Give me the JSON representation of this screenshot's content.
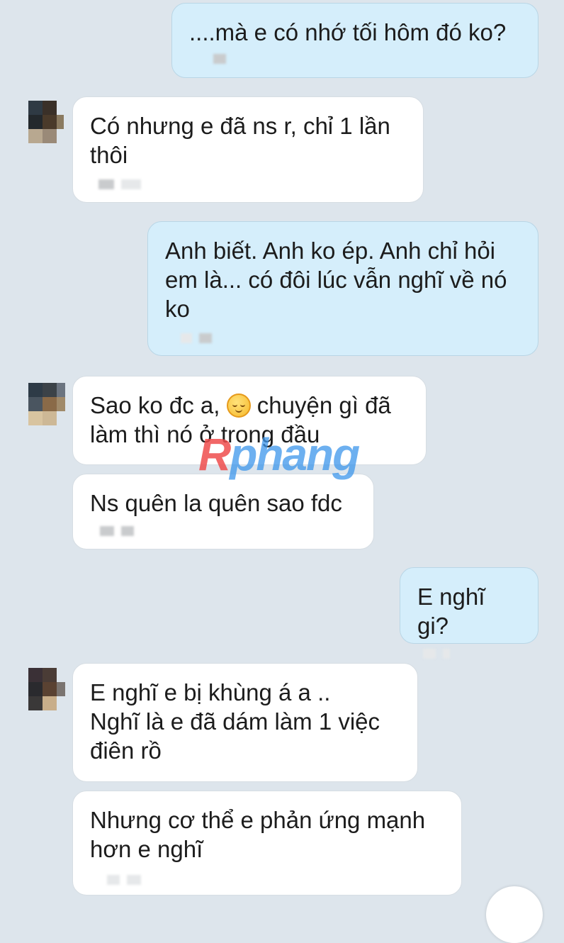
{
  "messages": [
    {
      "side": "out",
      "text": "....mà e có nhớ tối hôm đó ko?"
    },
    {
      "side": "in",
      "text": "Có nhưng e đã ns r, chỉ 1 lần thôi"
    },
    {
      "side": "out",
      "text": "Anh biết. Anh ko ép. Anh chỉ hỏi em là... có đôi lúc vẫn nghĩ về nó ko"
    },
    {
      "side": "in",
      "text_before_emoji": "Sao ko đc a,",
      "emoji": "relieved-face-emoji",
      "text_after_emoji": "chuyện gì đã làm thì nó ở trong đầu"
    },
    {
      "side": "in",
      "text": "Ns quên la quên sao fdc"
    },
    {
      "side": "out",
      "text": "E nghĩ gi?"
    },
    {
      "side": "in",
      "text": "E nghĩ e bị khùng á a ..\nNghĩ là e đã dám làm 1 việc điên rồ"
    },
    {
      "side": "in",
      "text": "Nhưng cơ thể e phản ứng mạnh hơn e nghĩ"
    }
  ],
  "watermark": {
    "part1": "R",
    "part2": "phang"
  },
  "colors": {
    "background": "#dde5ec",
    "incoming_bubble": "#ffffff",
    "outgoing_bubble": "#d5eefb",
    "text": "#1c1c1c"
  }
}
